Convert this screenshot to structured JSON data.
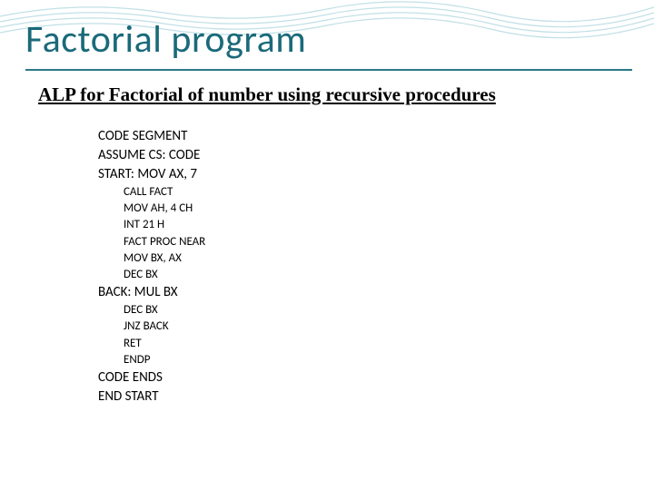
{
  "title": "Factorial program",
  "subtitle": "ALP for Factorial of number using recursive procedures",
  "code": {
    "lines": [
      {
        "text": "CODE SEGMENT",
        "indent": 0
      },
      {
        "text": "ASSUME CS: CODE",
        "indent": 0
      },
      {
        "text": "START: MOV AX, 7",
        "indent": 0
      },
      {
        "text": "CALL FACT",
        "indent": 1
      },
      {
        "text": "MOV AH, 4 CH",
        "indent": 1
      },
      {
        "text": "INT 21 H",
        "indent": 1
      },
      {
        "text": "FACT PROC NEAR",
        "indent": 1
      },
      {
        "text": "MOV BX, AX",
        "indent": 1
      },
      {
        "text": "DEC BX",
        "indent": 1
      },
      {
        "text": "BACK: MUL BX",
        "indent": 0
      },
      {
        "text": "DEC BX",
        "indent": 1
      },
      {
        "text": "JNZ BACK",
        "indent": 1
      },
      {
        "text": "RET",
        "indent": 1
      },
      {
        "text": "ENDP",
        "indent": 1
      },
      {
        "text": "CODE ENDS",
        "indent": 0
      },
      {
        "text": "END START",
        "indent": 0
      }
    ]
  }
}
